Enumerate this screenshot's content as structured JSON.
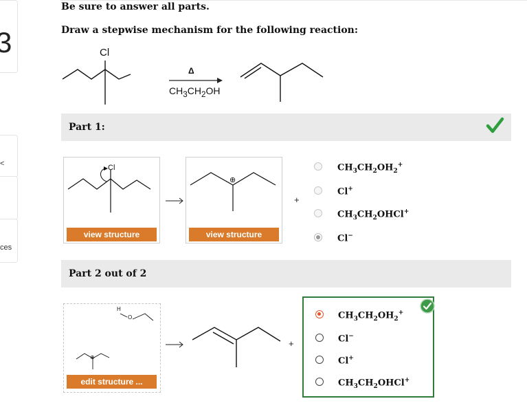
{
  "instructions": {
    "line1": "Be sure to answer all parts.",
    "line2": "Draw a stepwise mechanism for the following reaction:"
  },
  "left_margin": {
    "question_number": "3",
    "fragment_1": "<",
    "fragment_2": "ces"
  },
  "reaction": {
    "reactant_atom": "Cl",
    "condition_top": "Δ",
    "condition_bottom_html": "CH<sub>3</sub>CH<sub>2</sub>OH"
  },
  "part1": {
    "label": "Part 1:",
    "status": "correct",
    "box1": {
      "atom_label": "Cl",
      "button_label": "view structure"
    },
    "box2": {
      "charge_symbol": "⊕",
      "button_label": "view structure"
    },
    "plus": "+",
    "options": [
      {
        "html": "CH<sub>3</sub>CH<sub>2</sub>OH<sub>2</sub><sup>+</sup>",
        "selected": false
      },
      {
        "html": "Cl<sup>+</sup>",
        "selected": false
      },
      {
        "html": "CH<sub>3</sub>CH<sub>2</sub>OHCl<sup>+</sup>",
        "selected": false
      },
      {
        "html": "Cl<sup>−</sup>",
        "selected": true
      }
    ]
  },
  "part2": {
    "label": "Part 2 out of 2",
    "status": "correct",
    "box1": {
      "atom_label": "H",
      "oxygen_label": "O",
      "charge_symbol": "⊕",
      "button_label": "edit structure ..."
    },
    "plus": "+",
    "options": [
      {
        "html": "CH<sub>3</sub>CH<sub>2</sub>OH<sub>2</sub><sup>+</sup>",
        "selected": true
      },
      {
        "html": "Cl<sup>−</sup>",
        "selected": false
      },
      {
        "html": "Cl<sup>+</sup>",
        "selected": false
      },
      {
        "html": "CH<sub>3</sub>CH<sub>2</sub>OHCl<sup>+</sup>",
        "selected": false
      }
    ]
  },
  "colors": {
    "accent_orange": "#d97b2b",
    "check_green": "#2f9e3f",
    "answer_border": "#2f7d3a",
    "selected_radio": "#e8552b"
  },
  "icons": {
    "part1_status": "checkmark-icon",
    "part2_status": "check-circle-icon",
    "reaction_arrow": "arrow-right-icon"
  }
}
